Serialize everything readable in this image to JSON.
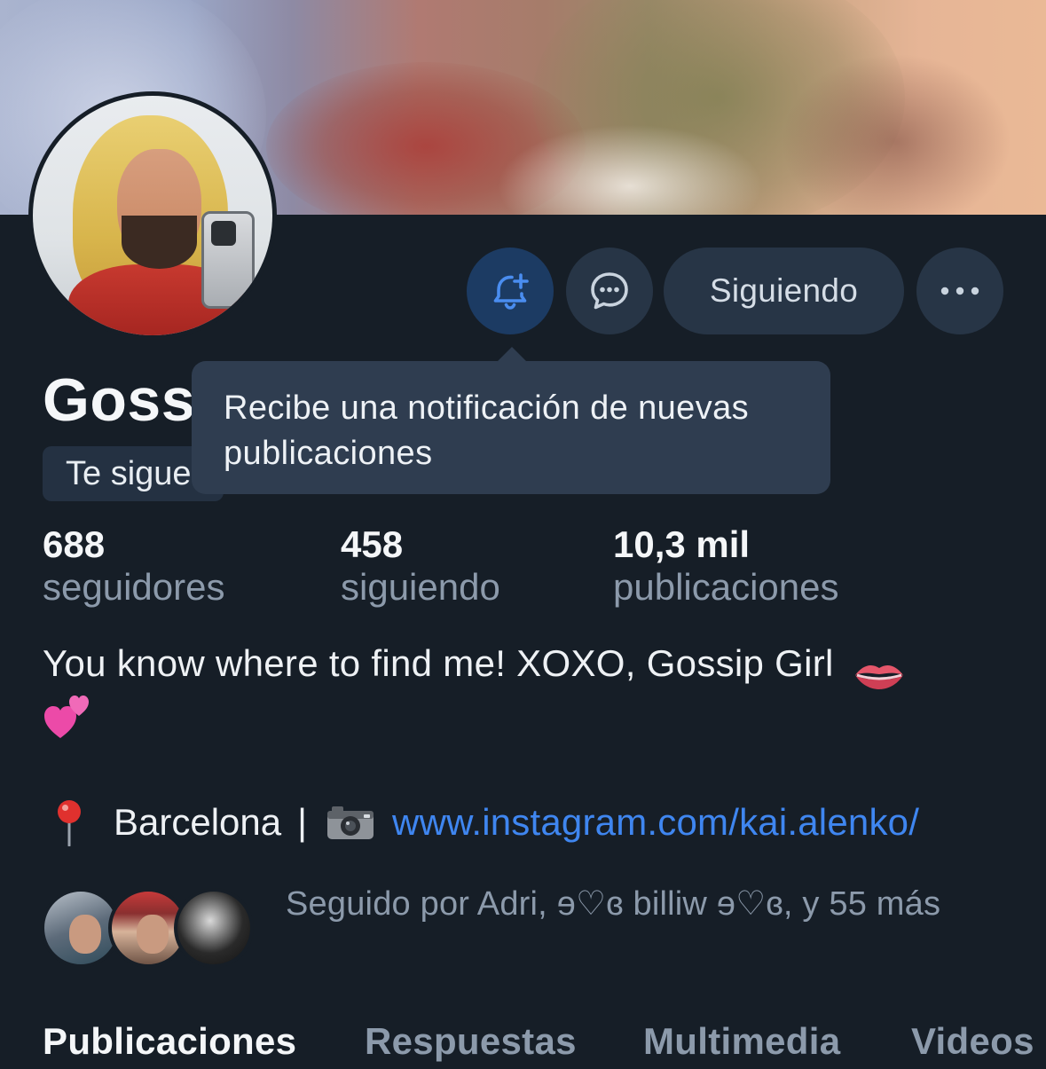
{
  "profile": {
    "name_partial": "Goss",
    "follows_you_badge_partial": "Te sigue",
    "bio_text": "You know where to find me! XOXO, Gossip Girl",
    "bio_emojis": [
      "lips-emoji",
      "two-hearts-emoji"
    ],
    "location": "Barcelona",
    "separator": "|",
    "link": "www.instagram.com/kai.alenko/"
  },
  "actions": {
    "notify_icon": "bell-plus-icon",
    "message_icon": "chat-bubble-icon",
    "follow_label": "Siguiendo",
    "more_icon": "ellipsis-icon"
  },
  "tooltip": {
    "text": "Recibe una notificación de nuevas publicaciones"
  },
  "stats": [
    {
      "value": "688",
      "label": "seguidores"
    },
    {
      "value": "458",
      "label": "siguiendo"
    },
    {
      "value": "10,3 mil",
      "label": "publicaciones"
    }
  ],
  "followed_by": {
    "text": "Seguido por Adri, ɘ♡ɞ billiw ɘ♡ɞ, y 55 más"
  },
  "tabs": [
    {
      "label": "Publicaciones",
      "active": true
    },
    {
      "label": "Respuestas",
      "active": false
    },
    {
      "label": "Multimedia",
      "active": false
    },
    {
      "label": "Videos",
      "active": false
    }
  ],
  "colors": {
    "background": "#161e27",
    "button_bg": "#273546",
    "notify_button_bg": "#1c3b63",
    "accent_blue": "#3f86f0",
    "muted_text": "#8c9aab",
    "tooltip_bg": "#2f3d50"
  }
}
